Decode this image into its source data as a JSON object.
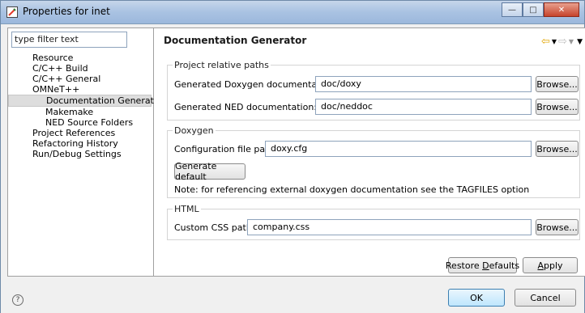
{
  "window": {
    "title": "Properties for inet"
  },
  "filter": {
    "placeholder": "type filter text"
  },
  "tree": [
    {
      "label": "Resource",
      "level": 1
    },
    {
      "label": "C/C++ Build",
      "level": 1
    },
    {
      "label": "C/C++ General",
      "level": 1
    },
    {
      "label": "OMNeT++",
      "level": 1
    },
    {
      "label": "Documentation Generator",
      "level": 2,
      "selected": true
    },
    {
      "label": "Makemake",
      "level": 2
    },
    {
      "label": "NED Source Folders",
      "level": 2
    },
    {
      "label": "Project References",
      "level": 1
    },
    {
      "label": "Refactoring History",
      "level": 1
    },
    {
      "label": "Run/Debug Settings",
      "level": 1
    }
  ],
  "page": {
    "title": "Documentation Generator"
  },
  "groups": {
    "paths": {
      "label": "Project relative paths",
      "doxygen_label": "Generated Doxygen documentation:",
      "doxygen_value": "doc/doxy",
      "ned_label": "Generated NED documentation:",
      "ned_value": "doc/neddoc"
    },
    "doxygen": {
      "label": "Doxygen",
      "config_label": "Configuration file path:",
      "config_value": "doxy.cfg",
      "generate_label": "Generate default",
      "note": "Note: for referencing external doxygen documentation see the TAGFILES option"
    },
    "html": {
      "label": "HTML",
      "css_label": "Custom CSS path:",
      "css_value": "company.css"
    }
  },
  "buttons": {
    "browse": "Browse...",
    "restore_pre": "Restore ",
    "restore_u": "D",
    "restore_post": "efaults",
    "apply_u": "A",
    "apply_post": "pply",
    "ok": "OK",
    "cancel": "Cancel"
  }
}
